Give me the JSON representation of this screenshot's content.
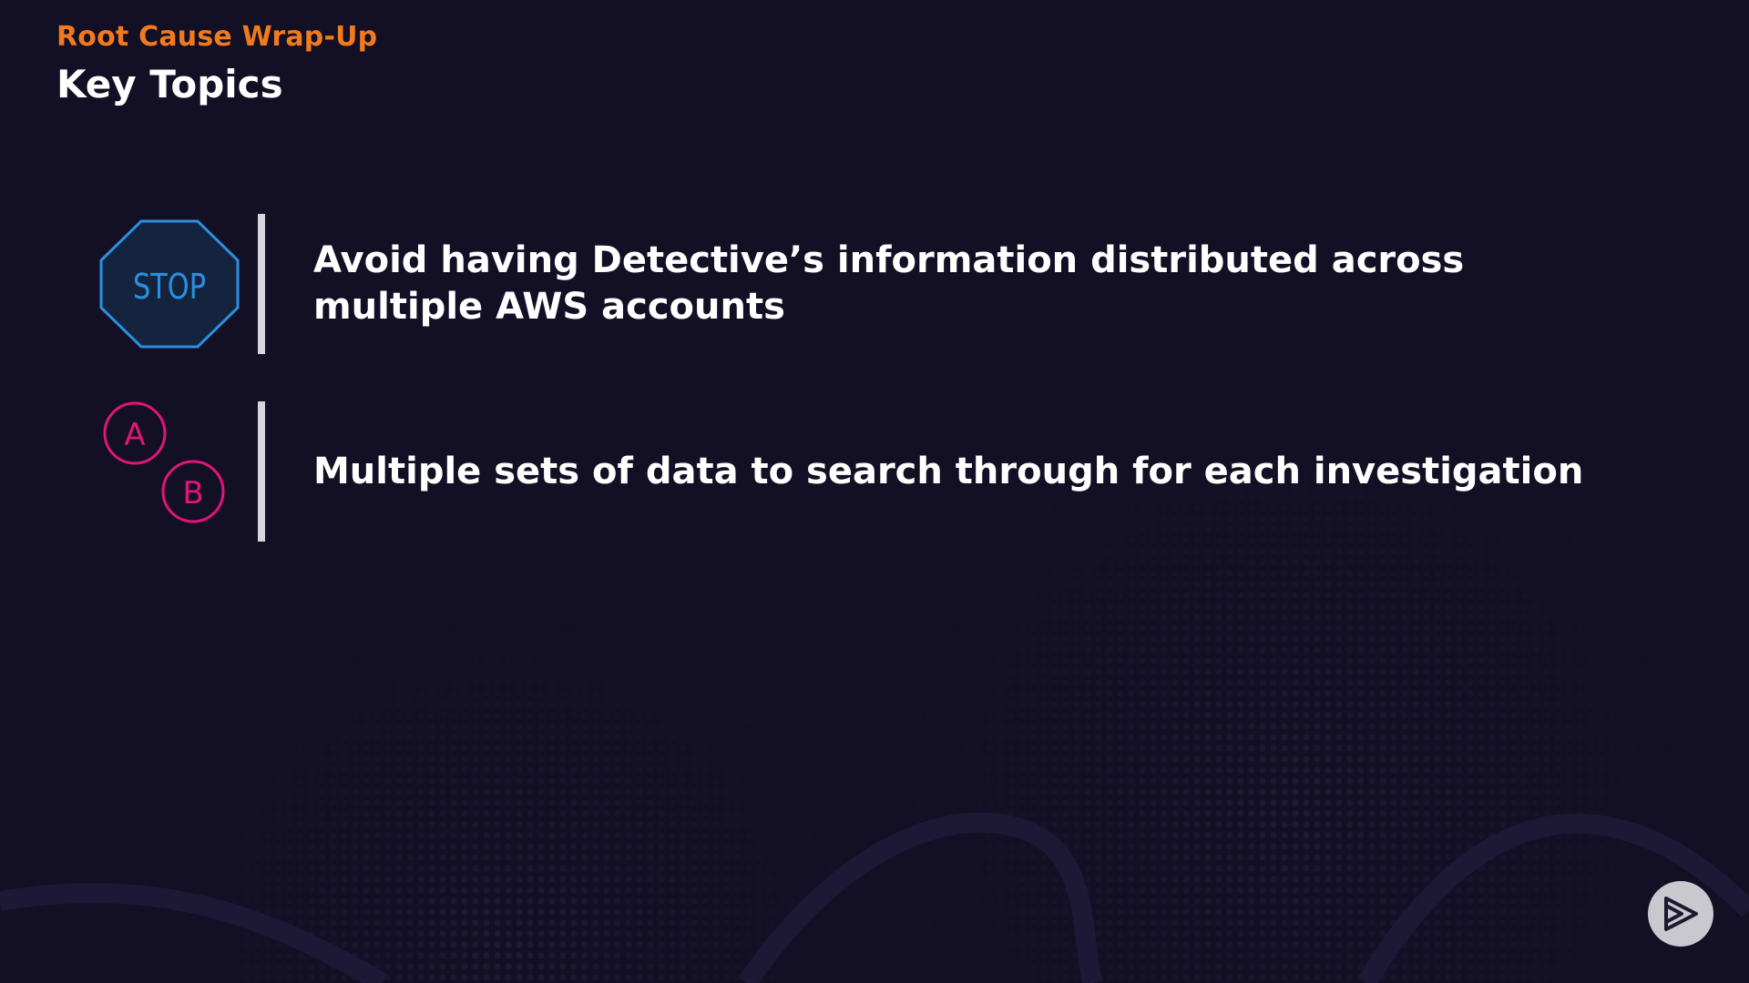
{
  "slide": {
    "section": "Root Cause Wrap-Up",
    "title": "Key Topics"
  },
  "topics": [
    {
      "icon": "stop-sign-icon",
      "icon_label": "STOP",
      "text": "Avoid having Detective’s information distributed across multiple AWS accounts"
    },
    {
      "icon": "a-b-circles-icon",
      "icon_labels": [
        "A",
        "B"
      ],
      "text": "Multiple sets of data to search through for each investigation"
    }
  ],
  "colors": {
    "background": "#130f24",
    "section_accent": "#f07a1e",
    "stop_stroke": "#2a8fe0",
    "ab_stroke": "#e0157a",
    "divider": "#d6d4dc",
    "logo_button": "#c9c8cf"
  },
  "logo": {
    "icon": "play-logo-icon"
  }
}
